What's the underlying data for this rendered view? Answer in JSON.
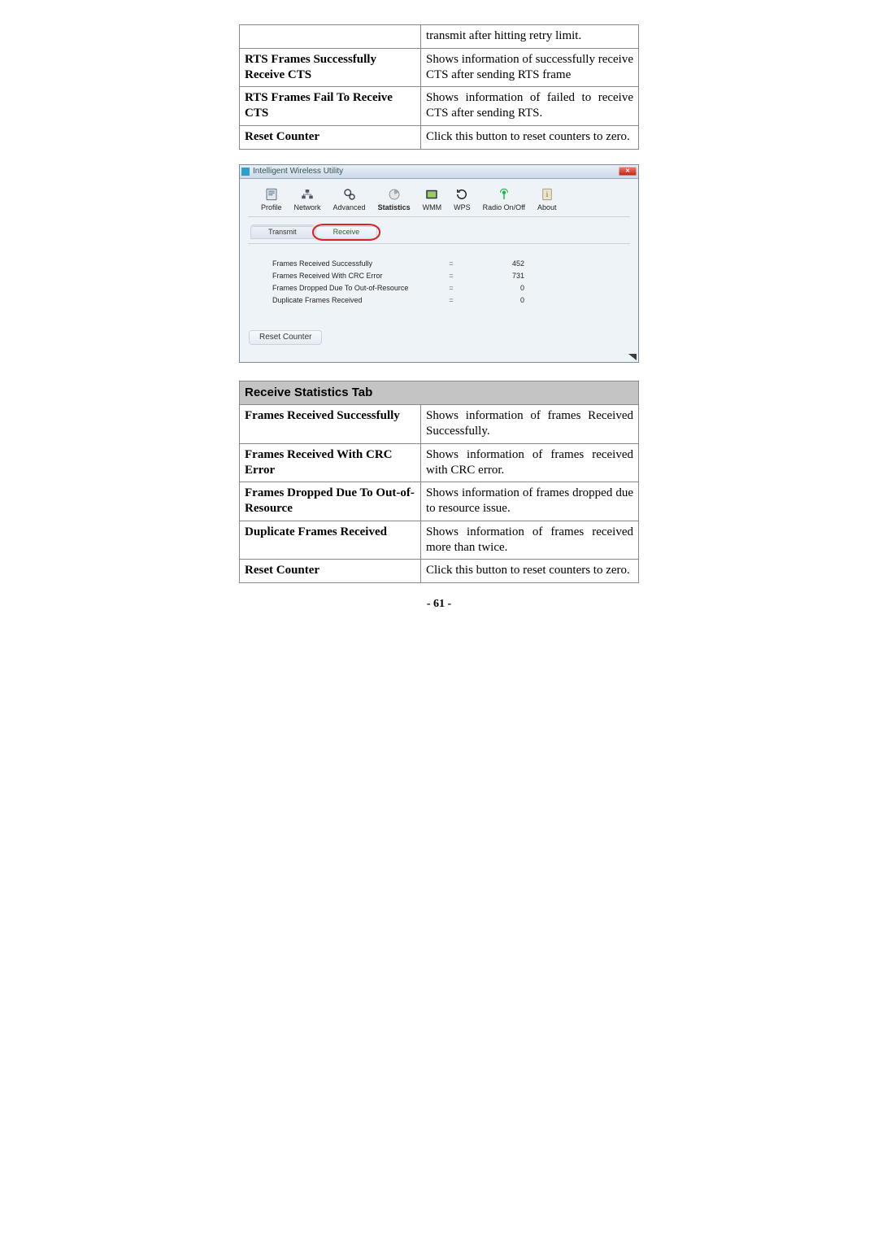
{
  "top_table": {
    "rows": [
      {
        "name": "",
        "desc": "transmit after hitting retry limit."
      },
      {
        "name": "RTS Frames Successfully Receive CTS",
        "desc": "Shows information of successfully receive CTS after sending RTS frame"
      },
      {
        "name": "RTS Frames Fail To Receive CTS",
        "desc": "Shows information of failed to receive CTS after sending RTS."
      },
      {
        "name": "Reset Counter",
        "desc": "Click this button to reset counters to zero."
      }
    ]
  },
  "app": {
    "title": "Intelligent Wireless Utility",
    "close_symbol": "✕",
    "toolbar": [
      {
        "id": "profile",
        "label": "Profile"
      },
      {
        "id": "network",
        "label": "Network"
      },
      {
        "id": "advanced",
        "label": "Advanced"
      },
      {
        "id": "statistics",
        "label": "Statistics"
      },
      {
        "id": "wmm",
        "label": "WMM"
      },
      {
        "id": "wps",
        "label": "WPS"
      },
      {
        "id": "radio",
        "label": "Radio On/Off"
      },
      {
        "id": "about",
        "label": "About"
      }
    ],
    "subtabs": {
      "transmit": "Transmit",
      "receive": "Receive"
    },
    "stats": [
      {
        "label": "Frames Received Successfully",
        "eq": "=",
        "value": "452"
      },
      {
        "label": "Frames Received With CRC Error",
        "eq": "=",
        "value": "731"
      },
      {
        "label": "Frames Dropped Due To Out-of-Resource",
        "eq": "=",
        "value": "0"
      },
      {
        "label": "Duplicate Frames Received",
        "eq": "=",
        "value": "0"
      }
    ],
    "reset_button": "Reset Counter"
  },
  "bottom_table": {
    "heading": "Receive Statistics Tab",
    "rows": [
      {
        "name": "Frames Received Successfully",
        "desc": "Shows information of frames Received Successfully."
      },
      {
        "name": "Frames Received With CRC Error",
        "desc": "Shows information of frames received with CRC error."
      },
      {
        "name": "Frames Dropped Due To Out-of-Resource",
        "desc": "Shows information of frames dropped due to resource issue."
      },
      {
        "name": "Duplicate Frames Received",
        "desc": "Shows information of frames received more than twice."
      },
      {
        "name": "Reset Counter",
        "desc": "Click this button to reset counters to zero."
      }
    ]
  },
  "page_number": "- 61 -"
}
